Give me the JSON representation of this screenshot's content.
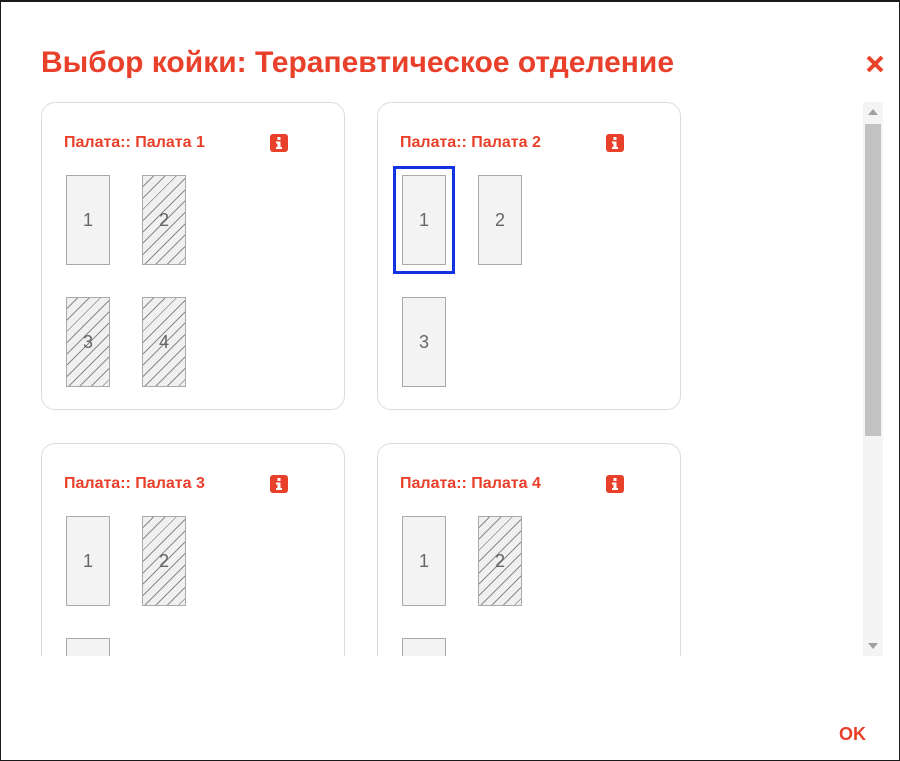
{
  "dialog": {
    "title": "Выбор койки: Терапевтическое отделение",
    "close_icon": "close-icon",
    "ok_label": "OK"
  },
  "colors": {
    "accent": "#e8402a",
    "selection": "#1433e0",
    "card_border": "#dcdcdc"
  },
  "rooms": [
    {
      "label": "Палата:: Палата 1",
      "beds": [
        {
          "number": "1",
          "occupied": false,
          "selected": false
        },
        {
          "number": "2",
          "occupied": true,
          "selected": false
        },
        {
          "number": "3",
          "occupied": true,
          "selected": false
        },
        {
          "number": "4",
          "occupied": true,
          "selected": false
        }
      ]
    },
    {
      "label": "Палата:: Палата 2",
      "beds": [
        {
          "number": "1",
          "occupied": false,
          "selected": true
        },
        {
          "number": "2",
          "occupied": false,
          "selected": false
        },
        {
          "number": "3",
          "occupied": false,
          "selected": false
        }
      ]
    },
    {
      "label": "Палата:: Палата 3",
      "beds": [
        {
          "number": "1",
          "occupied": false,
          "selected": false
        },
        {
          "number": "2",
          "occupied": true,
          "selected": false
        },
        {
          "number": "",
          "occupied": false,
          "selected": false
        }
      ]
    },
    {
      "label": "Палата:: Палата 4",
      "beds": [
        {
          "number": "1",
          "occupied": false,
          "selected": false
        },
        {
          "number": "2",
          "occupied": true,
          "selected": false
        },
        {
          "number": "",
          "occupied": false,
          "selected": false
        }
      ]
    }
  ]
}
